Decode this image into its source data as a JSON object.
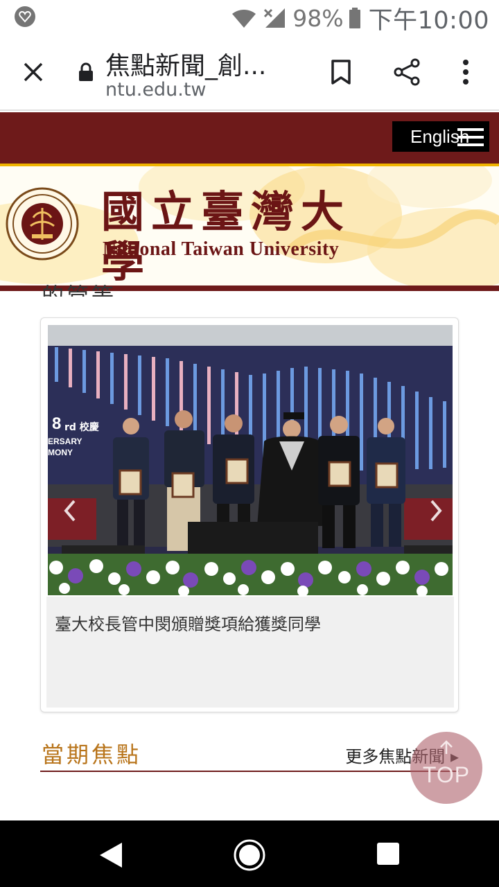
{
  "status_bar": {
    "battery_percent": "98%",
    "time": "下午10:00",
    "icons": [
      "app-notification-icon",
      "wifi-icon",
      "cell-signal-icon",
      "battery-icon"
    ]
  },
  "browser": {
    "page_title": "焦點新聞_創...",
    "url": "ntu.edu.tw",
    "icons": [
      "close-icon",
      "lock-icon",
      "bookmark-icon",
      "share-icon",
      "more-vert-icon"
    ]
  },
  "site": {
    "lang_button": "English",
    "logo_zh": "國立臺灣大學",
    "logo_en": "National Taiwan University",
    "brand_color": "#6e1a1a",
    "gold": "#f0b400"
  },
  "content": {
    "clipped_heading": "的管等",
    "carousel": {
      "caption": "臺大校長管中閔頒贈獎項給獲獎同學",
      "photo_stage_text": "rd 校慶",
      "photo_stage_text2": "ERSARY",
      "photo_stage_text3": "MONY"
    },
    "section": {
      "title": "當期焦點",
      "more_link": "更多焦點新聞 ▸"
    },
    "top_button": "TOP"
  },
  "nav_bar": {
    "icons": [
      "back-icon",
      "home-icon",
      "recents-icon"
    ]
  }
}
